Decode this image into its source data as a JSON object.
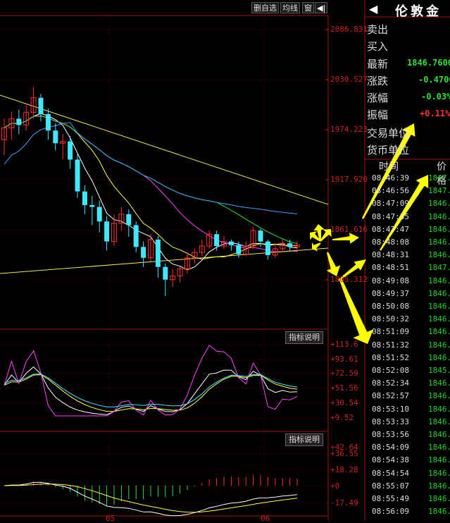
{
  "toolbar": {
    "delete_label": "删自选",
    "avg_label": "均线",
    "window_label": "窗",
    "nav_label": "◀|"
  },
  "price_axis": [
    "2086.831",
    "2030.527",
    "1974.223",
    "1917.920",
    "1861.616",
    "1805.312"
  ],
  "indicator1": {
    "button": "指标说明",
    "axis": [
      "+113.6",
      "+93.61",
      "+72.59",
      "+51.56",
      "+30.54",
      "+9.52"
    ]
  },
  "indicator2": {
    "button": "指标说明",
    "axis": [
      "+42.64",
      "+36.55",
      "+18.28",
      "+0",
      "-17.49"
    ]
  },
  "date_labels": [
    "05",
    "06"
  ],
  "quote": {
    "nav_icon": "◀",
    "title": "伦敦金",
    "rows": [
      {
        "label": "卖出",
        "value": ""
      },
      {
        "label": "买入",
        "value": ""
      },
      {
        "label": "最新",
        "value": "1846.7600"
      },
      {
        "label": "涨跌",
        "value": "-0.4700"
      },
      {
        "label": "涨幅",
        "value": "-0.03%"
      },
      {
        "label": "振幅",
        "value": "+0.11%"
      },
      {
        "label": "交易单位",
        "value": ""
      },
      {
        "label": "货币单位",
        "value": ""
      }
    ],
    "colors": {
      "up": "#ff3333",
      "down": "#2fe02f"
    }
  },
  "ticks": {
    "headers": [
      "时间",
      "价格"
    ],
    "rows": [
      {
        "time": "08:46:39",
        "price": "1847."
      },
      {
        "time": "08:46:56",
        "price": "1847."
      },
      {
        "time": "08:47:09",
        "price": "1846."
      },
      {
        "time": "08:47:35",
        "price": "1846."
      },
      {
        "time": "08:47:47",
        "price": "1846."
      },
      {
        "time": "08:48:08",
        "price": "1846."
      },
      {
        "time": "08:48:31",
        "price": "1846."
      },
      {
        "time": "08:48:51",
        "price": "1847."
      },
      {
        "time": "08:49:08",
        "price": "1846."
      },
      {
        "time": "08:49:37",
        "price": "1846."
      },
      {
        "time": "08:50:08",
        "price": "1846."
      },
      {
        "time": "08:50:32",
        "price": "1846."
      },
      {
        "time": "08:51:09",
        "price": "1846."
      },
      {
        "time": "08:51:32",
        "price": "1846."
      },
      {
        "time": "08:51:52",
        "price": "1846."
      },
      {
        "time": "08:52:08",
        "price": "1845."
      },
      {
        "time": "08:52:34",
        "price": "1846."
      },
      {
        "time": "08:52:57",
        "price": "1846."
      },
      {
        "time": "08:53:10",
        "price": "1846."
      },
      {
        "time": "08:53:33",
        "price": "1846."
      },
      {
        "time": "08:53:56",
        "price": "1846."
      },
      {
        "time": "08:54:09",
        "price": "1846."
      },
      {
        "time": "08:54:38",
        "price": "1846."
      },
      {
        "time": "08:54:54",
        "price": "1846."
      },
      {
        "time": "08:55:07",
        "price": "1846."
      },
      {
        "time": "08:55:49",
        "price": "1846."
      },
      {
        "time": "08:56:09",
        "price": "1846."
      }
    ]
  },
  "chart_data": {
    "type": "candlestick",
    "price_range": [
      1790,
      2100
    ],
    "candles": [
      [
        1962,
        1975,
        1945,
        1985
      ],
      [
        1975,
        1985,
        1962,
        1993
      ],
      [
        1985,
        1978,
        1968,
        1995
      ],
      [
        1978,
        1992,
        1972,
        2000
      ],
      [
        1992,
        2008,
        1985,
        2020
      ],
      [
        2008,
        1990,
        1982,
        2012
      ],
      [
        1990,
        1972,
        1962,
        1996
      ],
      [
        1972,
        1958,
        1950,
        1980
      ],
      [
        1958,
        1960,
        1940,
        1968
      ],
      [
        1960,
        1940,
        1930,
        1966
      ],
      [
        1940,
        1905,
        1898,
        1946
      ],
      [
        1905,
        1890,
        1880,
        1912
      ],
      [
        1890,
        1888,
        1868,
        1900
      ],
      [
        1888,
        1872,
        1860,
        1895
      ],
      [
        1872,
        1850,
        1840,
        1878
      ],
      [
        1850,
        1870,
        1845,
        1880
      ],
      [
        1870,
        1880,
        1862,
        1888
      ],
      [
        1880,
        1868,
        1855,
        1885
      ],
      [
        1868,
        1844,
        1838,
        1872
      ],
      [
        1844,
        1832,
        1822,
        1850
      ],
      [
        1832,
        1852,
        1828,
        1858
      ],
      [
        1852,
        1822,
        1810,
        1856
      ],
      [
        1822,
        1808,
        1790,
        1826
      ],
      [
        1808,
        1812,
        1800,
        1820
      ],
      [
        1812,
        1820,
        1805,
        1822
      ],
      [
        1820,
        1832,
        1815,
        1838
      ],
      [
        1832,
        1838,
        1826,
        1842
      ],
      [
        1838,
        1845,
        1834,
        1852
      ],
      [
        1845,
        1858,
        1842,
        1862
      ],
      [
        1858,
        1845,
        1840,
        1862
      ],
      [
        1845,
        1850,
        1842,
        1856
      ],
      [
        1850,
        1846,
        1840,
        1852
      ],
      [
        1846,
        1836,
        1832,
        1850
      ],
      [
        1836,
        1845,
        1834,
        1850
      ],
      [
        1845,
        1862,
        1842,
        1866
      ],
      [
        1862,
        1850,
        1844,
        1864
      ],
      [
        1850,
        1835,
        1830,
        1852
      ],
      [
        1835,
        1842,
        1832,
        1848
      ],
      [
        1842,
        1848,
        1838,
        1852
      ],
      [
        1848,
        1844,
        1840,
        1852
      ],
      [
        1844,
        1846,
        1838,
        1850
      ]
    ]
  }
}
